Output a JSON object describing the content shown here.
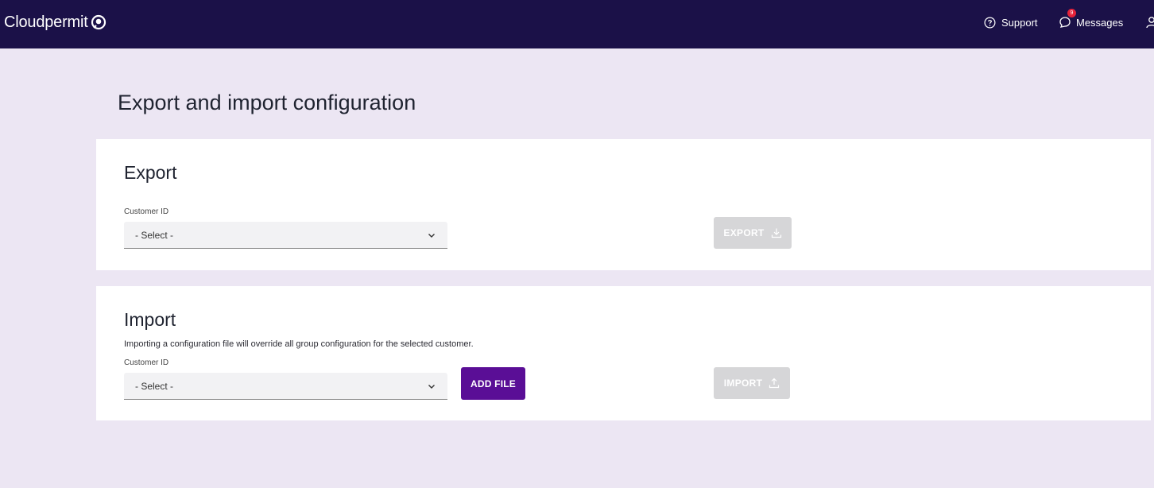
{
  "header": {
    "brand": "Cloudpermit",
    "support_label": "Support",
    "messages_label": "Messages",
    "messages_badge": "9"
  },
  "page": {
    "title": "Export and import configuration"
  },
  "export": {
    "title": "Export",
    "customer_label": "Customer ID",
    "select_value": "- Select -",
    "button_label": "EXPORT"
  },
  "import": {
    "title": "Import",
    "description": "Importing a configuration file will override all group configuration for the selected customer.",
    "customer_label": "Customer ID",
    "select_value": "- Select -",
    "add_file_label": "ADD FILE",
    "button_label": "IMPORT"
  },
  "colors": {
    "header_bg": "#1b1148",
    "page_bg": "#ece6f3",
    "primary": "#5a0e96",
    "disabled": "#d6d6d8",
    "badge": "#e5233a"
  }
}
